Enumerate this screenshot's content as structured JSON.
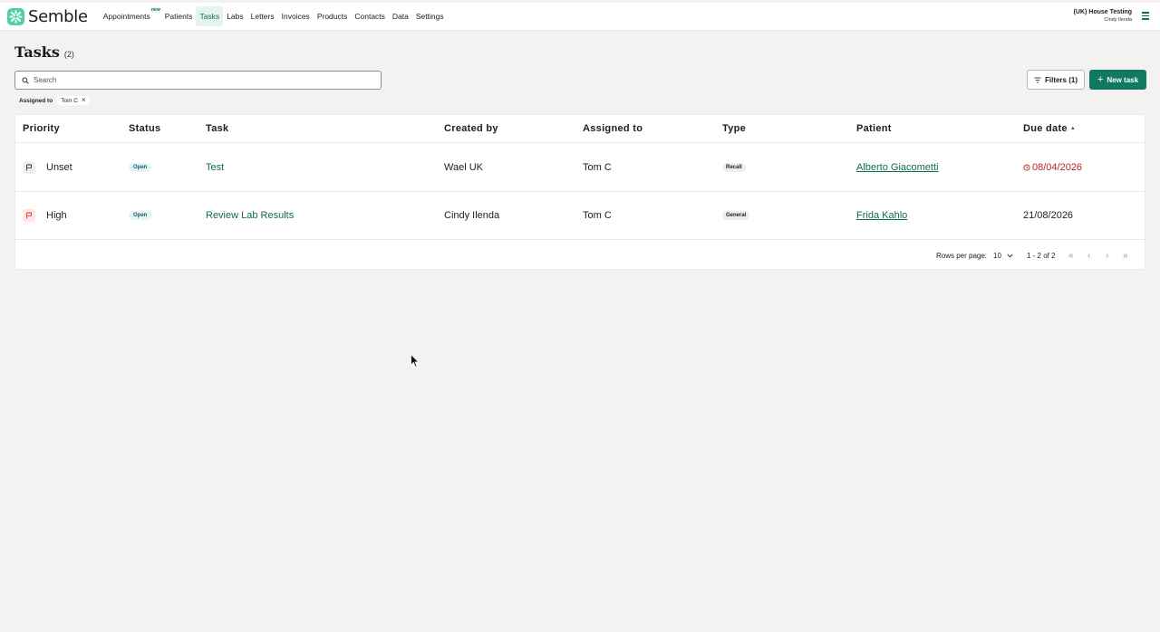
{
  "brand": {
    "name": "Semble"
  },
  "nav": {
    "items": [
      {
        "label": "Appointments",
        "badge": "new"
      },
      {
        "label": "Patients"
      },
      {
        "label": "Tasks",
        "active": true
      },
      {
        "label": "Labs"
      },
      {
        "label": "Letters"
      },
      {
        "label": "Invoices"
      },
      {
        "label": "Products"
      },
      {
        "label": "Contacts"
      },
      {
        "label": "Data"
      },
      {
        "label": "Settings"
      }
    ]
  },
  "account": {
    "org": "(UK) House Testing",
    "user": "Cindy Ilenda"
  },
  "page": {
    "title": "Tasks",
    "count": "(2)"
  },
  "search": {
    "placeholder": "Search"
  },
  "toolbar": {
    "filters_label": "Filters (1)",
    "new_task_label": "New task"
  },
  "active_filter": {
    "label": "Assigned to",
    "value": "Tom C"
  },
  "table": {
    "columns": [
      "Priority",
      "Status",
      "Task",
      "Created by",
      "Assigned to",
      "Type",
      "Patient",
      "Due date"
    ],
    "rows": [
      {
        "priority": "Unset",
        "status": "Open",
        "task": "Test",
        "created_by": "Wael UK",
        "assigned_to": "Tom C",
        "type": "Recall",
        "patient": "Alberto Giacometti",
        "due_date": "08/04/2026"
      },
      {
        "priority": "High",
        "status": "Open",
        "task": "Review Lab Results",
        "created_by": "Cindy Ilenda",
        "assigned_to": "Tom C",
        "type": "General",
        "patient": "Frida Kahlo",
        "due_date": "21/08/2026"
      }
    ]
  },
  "pagination": {
    "rows_label": "Rows per page:",
    "rows_value": "10",
    "range": "1 - 2 of 2"
  },
  "colors": {
    "accent": "#0f7a61",
    "overdue": "#b4222c",
    "logo": "#4fd1a1"
  }
}
